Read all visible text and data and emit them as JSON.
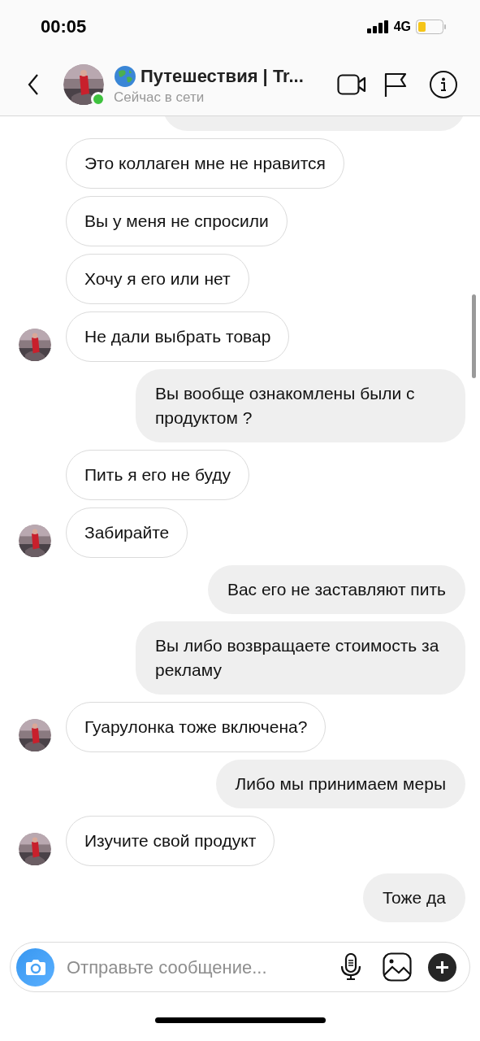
{
  "status_bar": {
    "time": "00:05",
    "network": "4G"
  },
  "header": {
    "title": "Путешествия | Tr...",
    "subtitle": "Сейчас в сети",
    "online": true
  },
  "messages": [
    {
      "kind": "incoming",
      "text": "Это коллаген мне не нравится",
      "avatar": false
    },
    {
      "kind": "incoming",
      "text": "Вы у меня не спросили",
      "avatar": false
    },
    {
      "kind": "incoming",
      "text": "Хочу я его или нет",
      "avatar": false
    },
    {
      "kind": "incoming",
      "text": "Не дали выбрать товар",
      "avatar": true
    },
    {
      "kind": "outgoing",
      "text": "Вы вообще ознакомлены были с продуктом ?"
    },
    {
      "kind": "incoming",
      "text": "Пить я его не буду",
      "avatar": false
    },
    {
      "kind": "incoming",
      "text": "Забирайте",
      "avatar": true
    },
    {
      "kind": "outgoing",
      "text": "Вас его не заставляют пить"
    },
    {
      "kind": "outgoing",
      "text": "Вы либо возвращаете стоимость за рекламу"
    },
    {
      "kind": "incoming",
      "text": "Гуарулонка тоже включена?",
      "avatar": true
    },
    {
      "kind": "outgoing",
      "text": "Либо мы принимаем меры"
    },
    {
      "kind": "incoming",
      "text": "Изучите свой продукт",
      "avatar": true
    },
    {
      "kind": "outgoing",
      "text": "Тоже да"
    }
  ],
  "composer": {
    "placeholder": "Отправьте сообщение..."
  }
}
